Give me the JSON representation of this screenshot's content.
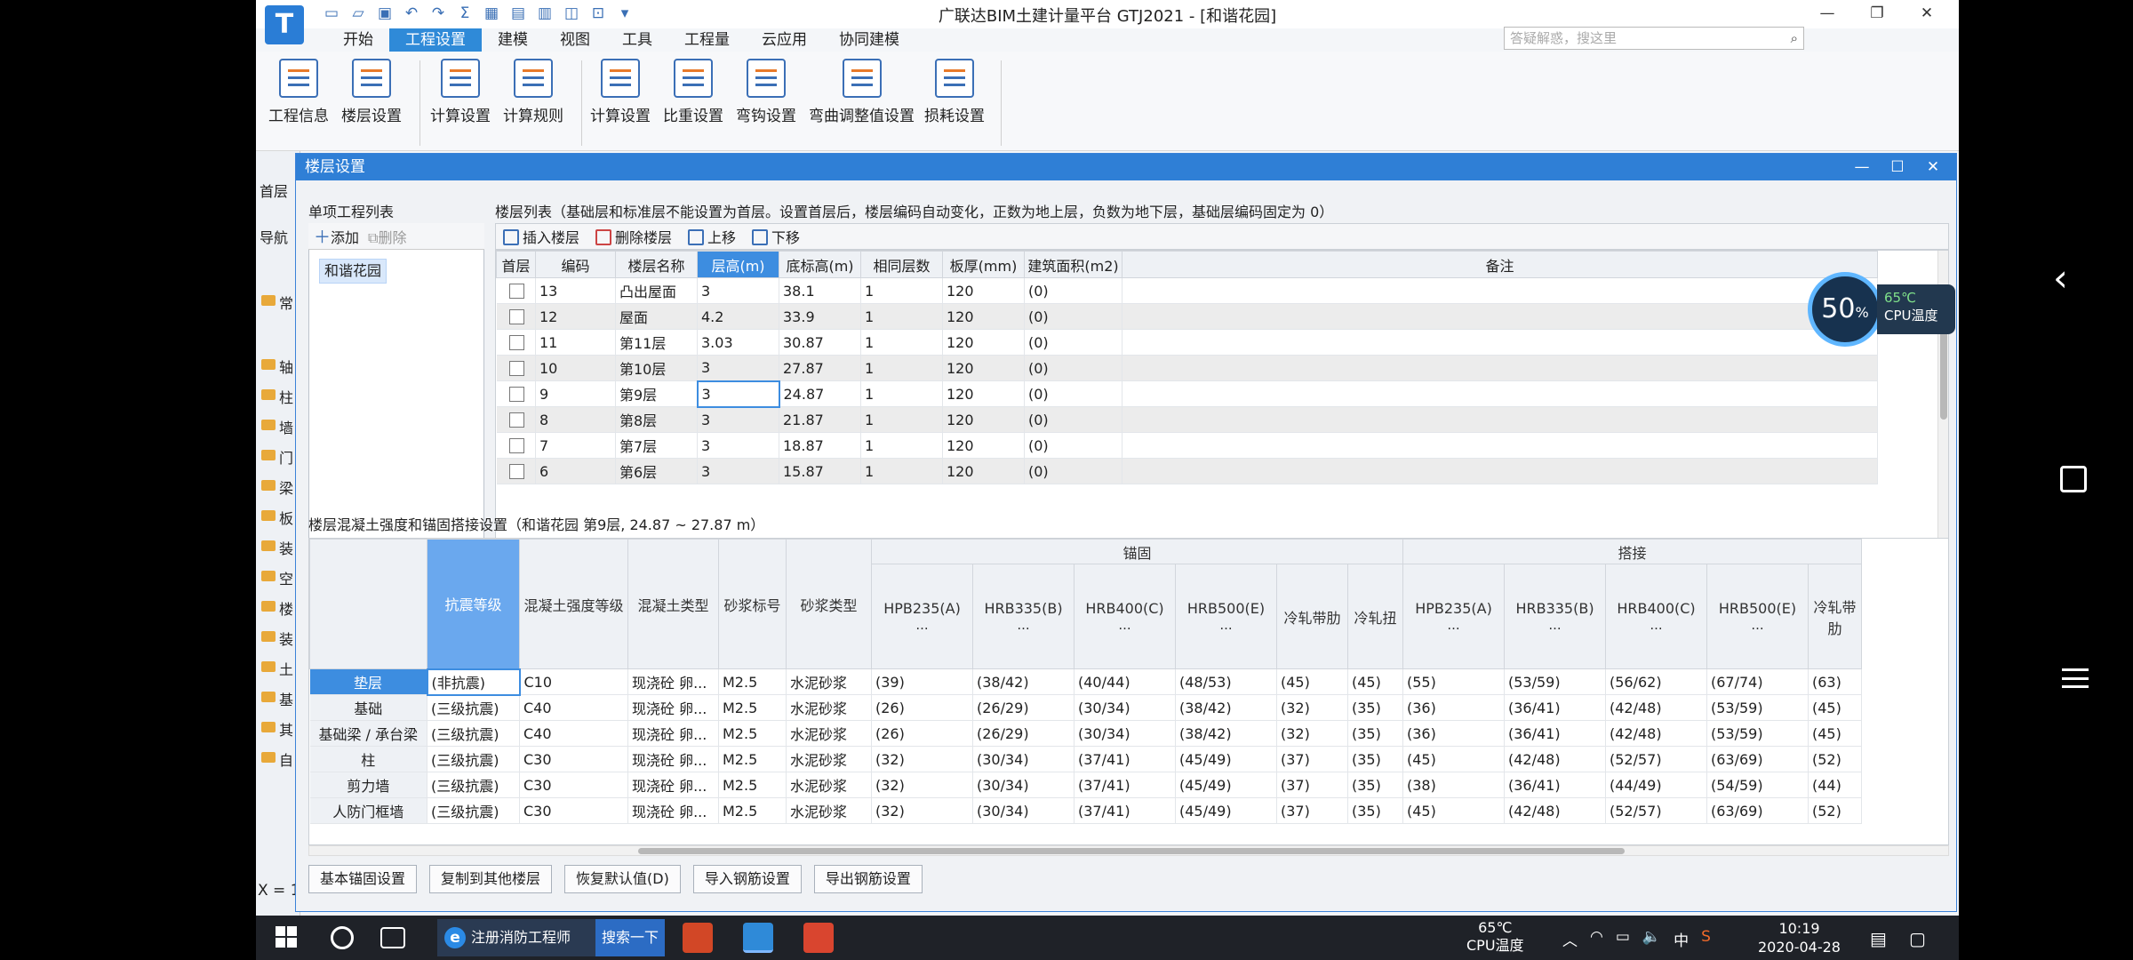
{
  "app": {
    "title": "广联达BIM土建计量平台 GTJ2021 - [和谐花园]",
    "logo": "T",
    "tabs": [
      "开始",
      "工程设置",
      "建模",
      "视图",
      "工具",
      "工程量",
      "云应用",
      "协同建模"
    ],
    "active_tab": "工程设置",
    "search_placeholder": "答疑解惑，搜这里"
  },
  "ribbon": {
    "buttons": [
      "工程信息",
      "楼层设置",
      "计算设置",
      "计算规则",
      "计算设置",
      "比重设置",
      "弯钩设置",
      "弯曲调整值设置",
      "损耗设置"
    ]
  },
  "left_panel": {
    "tab_label": "首层",
    "nav_label": "导航",
    "items": [
      "常",
      "轴",
      "柱",
      "墙",
      "门",
      "梁",
      "板",
      "装",
      "空",
      "楼",
      "装",
      "土",
      "基",
      "其",
      "自"
    ],
    "coord": "X = 1"
  },
  "dialog": {
    "title": "楼层设置",
    "project_list_label": "单项工程列表",
    "add_label": "添加",
    "delete_label": "删除",
    "project_item": "和谐花园",
    "floor_list_label": "楼层列表（基础层和标准层不能设置为首层。设置首层后，楼层编码自动变化，正数为地上层，负数为地下层，基础层编码固定为 0）",
    "floor_toolbar": {
      "insert": "插入楼层",
      "delete": "删除楼层",
      "up": "上移",
      "down": "下移"
    },
    "floor_columns": [
      "首层",
      "编码",
      "楼层名称",
      "层高(m)",
      "底标高(m)",
      "相同层数",
      "板厚(mm)",
      "建筑面积(m2)",
      "备注"
    ],
    "floor_rows": [
      {
        "code": "13",
        "name": "凸出屋面",
        "height": "3",
        "bottom": "38.1",
        "same": "1",
        "thick": "120",
        "area": "(0)"
      },
      {
        "code": "12",
        "name": "屋面",
        "height": "4.2",
        "bottom": "33.9",
        "same": "1",
        "thick": "120",
        "area": "(0)"
      },
      {
        "code": "11",
        "name": "第11层",
        "height": "3.03",
        "bottom": "30.87",
        "same": "1",
        "thick": "120",
        "area": "(0)"
      },
      {
        "code": "10",
        "name": "第10层",
        "height": "3",
        "bottom": "27.87",
        "same": "1",
        "thick": "120",
        "area": "(0)"
      },
      {
        "code": "9",
        "name": "第9层",
        "height": "3",
        "bottom": "24.87",
        "same": "1",
        "thick": "120",
        "area": "(0)"
      },
      {
        "code": "8",
        "name": "第8层",
        "height": "3",
        "bottom": "21.87",
        "same": "1",
        "thick": "120",
        "area": "(0)"
      },
      {
        "code": "7",
        "name": "第7层",
        "height": "3",
        "bottom": "18.87",
        "same": "1",
        "thick": "120",
        "area": "(0)"
      },
      {
        "code": "6",
        "name": "第6层",
        "height": "3",
        "bottom": "15.87",
        "same": "1",
        "thick": "120",
        "area": "(0)"
      }
    ],
    "rebar_section_label": "楼层混凝土强度和锚固搭接设置（和谐花园 第9层, 24.87 ~ 27.87 m）",
    "rebar_group_anchor": "锚固",
    "rebar_group_lap": "搭接",
    "rebar_columns": [
      "抗震等级",
      "混凝土强度等级",
      "混凝土类型",
      "砂浆标号",
      "砂浆类型"
    ],
    "anchor_columns": [
      "HPB235(A)",
      "HRB335(B)",
      "HRB400(C)",
      "HRB500(E)",
      "冷轧带肋",
      "冷轧扭"
    ],
    "lap_columns": [
      "HPB235(A)",
      "HRB335(B)",
      "HRB400(C)",
      "HRB500(E)",
      "冷轧带肋"
    ],
    "col_suffix": "...",
    "rebar_rows": [
      {
        "name": "垫层",
        "seismic": "(非抗震)",
        "grade": "C10",
        "type": "现浇砼 卵...",
        "mortar": "M2.5",
        "mtype": "水泥砂浆",
        "anchor": [
          "(39)",
          "(38/42)",
          "(40/44)",
          "(48/53)",
          "(45)",
          "(45)"
        ],
        "lap": [
          "(55)",
          "(53/59)",
          "(56/62)",
          "(67/74)",
          "(63)"
        ]
      },
      {
        "name": "基础",
        "seismic": "(三级抗震)",
        "grade": "C40",
        "type": "现浇砼 卵...",
        "mortar": "M2.5",
        "mtype": "水泥砂浆",
        "anchor": [
          "(26)",
          "(26/29)",
          "(30/34)",
          "(38/42)",
          "(32)",
          "(35)"
        ],
        "lap": [
          "(36)",
          "(36/41)",
          "(42/48)",
          "(53/59)",
          "(45)"
        ]
      },
      {
        "name": "基础梁 / 承台梁",
        "seismic": "(三级抗震)",
        "grade": "C40",
        "type": "现浇砼 卵...",
        "mortar": "M2.5",
        "mtype": "水泥砂浆",
        "anchor": [
          "(26)",
          "(26/29)",
          "(30/34)",
          "(38/42)",
          "(32)",
          "(35)"
        ],
        "lap": [
          "(36)",
          "(36/41)",
          "(42/48)",
          "(53/59)",
          "(45)"
        ]
      },
      {
        "name": "柱",
        "seismic": "(三级抗震)",
        "grade": "C30",
        "type": "现浇砼 卵...",
        "mortar": "M2.5",
        "mtype": "水泥砂浆",
        "anchor": [
          "(32)",
          "(30/34)",
          "(37/41)",
          "(45/49)",
          "(37)",
          "(35)"
        ],
        "lap": [
          "(45)",
          "(42/48)",
          "(52/57)",
          "(63/69)",
          "(52)"
        ]
      },
      {
        "name": "剪力墙",
        "seismic": "(三级抗震)",
        "grade": "C30",
        "type": "现浇砼 卵...",
        "mortar": "M2.5",
        "mtype": "水泥砂浆",
        "anchor": [
          "(32)",
          "(30/34)",
          "(37/41)",
          "(45/49)",
          "(37)",
          "(35)"
        ],
        "lap": [
          "(38)",
          "(36/41)",
          "(44/49)",
          "(54/59)",
          "(44)"
        ]
      },
      {
        "name": "人防门框墙",
        "seismic": "(三级抗震)",
        "grade": "C30",
        "type": "现浇砼 卵...",
        "mortar": "M2.5",
        "mtype": "水泥砂浆",
        "anchor": [
          "(32)",
          "(30/34)",
          "(37/41)",
          "(45/49)",
          "(37)",
          "(35)"
        ],
        "lap": [
          "(45)",
          "(42/48)",
          "(52/57)",
          "(63/69)",
          "(52)"
        ]
      }
    ],
    "buttons": [
      "基本锚固设置",
      "复制到其他楼层",
      "恢复默认值(D)",
      "导入钢筋设置",
      "导出钢筋设置"
    ]
  },
  "overlay": {
    "cpu_percent": "50",
    "cpu_percent_unit": "%",
    "cpu_temp": "65℃",
    "cpu_label": "CPU温度"
  },
  "taskbar": {
    "app_label": "注册消防工程师",
    "search_label": "搜索一下",
    "temp": "65℃",
    "temp_label": "CPU温度",
    "ime": "中",
    "time": "10:19",
    "date": "2020-04-28"
  }
}
